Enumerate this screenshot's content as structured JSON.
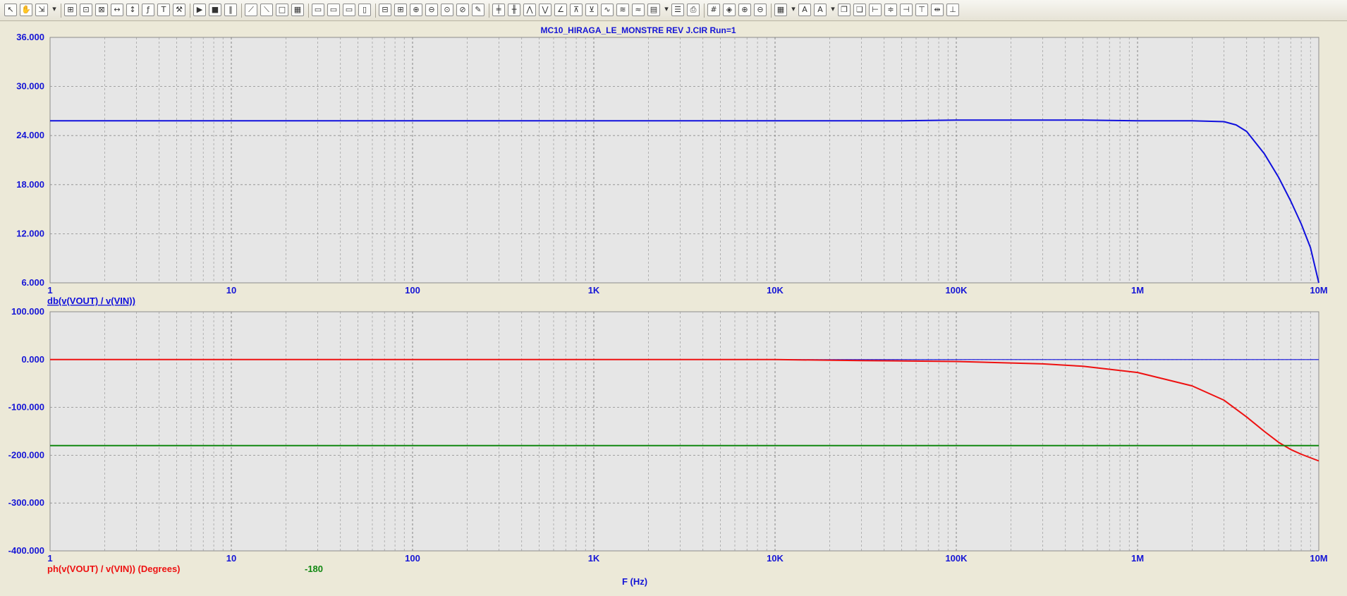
{
  "window": {
    "title": "MC10_HIRAGA_LE_MONSTRE REV J.CIR Run=1",
    "xaxis_label": "F (Hz)"
  },
  "toolbar": {
    "icons": [
      "select-arrow-icon",
      "pan-hand-icon",
      "pointer-menu-icon",
      "dropdown-arrow-icon",
      "scale-icon",
      "zoom-window-icon",
      "zoom-region-icon",
      "zoom-x-icon",
      "zoom-y-icon",
      "formula-icon",
      "text-icon",
      "tools-icon",
      "run-icon",
      "stop-icon",
      "pause-icon",
      "cursor-left-icon",
      "cursor-right-icon",
      "box-icon",
      "grid-box-icon",
      "plot-a-icon",
      "plot-b-icon",
      "plot-c-icon",
      "plot-d-icon",
      "h-split-icon",
      "v-split-icon",
      "zoom-in-icon",
      "zoom-out-icon",
      "zoom-fit-icon",
      "zoom-prev-icon",
      "edit-icon",
      "tag-1-icon",
      "tag-2-icon",
      "peak-icon",
      "valley-icon",
      "slope-icon",
      "high-icon",
      "low-icon",
      "inflection-icon",
      "global-high-icon",
      "global-low-icon",
      "clipboard-icon",
      "dropdown-arrow-icon",
      "properties-icon",
      "print-icon",
      "grid-icon",
      "marker-icon",
      "magnify-plus-icon",
      "magnify-minus-icon",
      "layout-icon",
      "dropdown-arrow-icon",
      "font-icon",
      "style-icon",
      "dropdown-arrow-icon",
      "copy-icon",
      "paste-icon",
      "align-left-icon",
      "align-center-icon",
      "align-right-icon",
      "align-top-icon",
      "distribute-icon",
      "align-bottom-icon"
    ]
  },
  "colors": {
    "plot_bg": "#e6e6e6",
    "axis_text": "#1515d6",
    "magnitude_trace": "#1010dd",
    "phase_trace": "#ee1111",
    "reference_line": "#118811",
    "zero_line": "#1010dd"
  },
  "chart_data": [
    {
      "type": "line",
      "title": "MC10_HIRAGA_LE_MONSTRE REV J.CIR Run=1",
      "xscale": "log",
      "xlim": [
        1,
        10000000
      ],
      "ylim": [
        6,
        36
      ],
      "x_ticks": [
        1,
        10,
        100,
        1000,
        10000,
        100000,
        1000000,
        10000000
      ],
      "x_tick_labels": [
        "1",
        "10",
        "100",
        "1K",
        "10K",
        "100K",
        "1M",
        "10M"
      ],
      "y_ticks": [
        6,
        12,
        18,
        24,
        30,
        36
      ],
      "y_tick_labels": [
        "6.000",
        "12.000",
        "18.000",
        "24.000",
        "30.000",
        "36.000"
      ],
      "grid": true,
      "xlabel": "",
      "series": [
        {
          "name": "db(v(VOUT) / v(VIN))",
          "x": [
            1,
            10,
            100,
            1000,
            10000,
            50000,
            100000,
            500000,
            1000000,
            2000000,
            3000000,
            3500000,
            4000000,
            5000000,
            6000000,
            7000000,
            8000000,
            9000000,
            10000000
          ],
          "y": [
            25.8,
            25.8,
            25.8,
            25.8,
            25.8,
            25.8,
            25.9,
            25.9,
            25.8,
            25.8,
            25.7,
            25.3,
            24.5,
            21.8,
            18.9,
            16.0,
            13.2,
            10.3,
            6.0
          ]
        }
      ]
    },
    {
      "type": "line",
      "xscale": "log",
      "xlim": [
        1,
        10000000
      ],
      "ylim": [
        -400,
        100
      ],
      "x_ticks": [
        1,
        10,
        100,
        1000,
        10000,
        100000,
        1000000,
        10000000
      ],
      "x_tick_labels": [
        "1",
        "10",
        "100",
        "1K",
        "10K",
        "100K",
        "1M",
        "10M"
      ],
      "y_ticks": [
        -400,
        -300,
        -200,
        -100,
        0,
        100
      ],
      "y_tick_labels": [
        "-400.000",
        "-300.000",
        "-200.000",
        "-100.000",
        "0.000",
        "100.000"
      ],
      "grid": true,
      "xlabel": "F (Hz)",
      "series": [
        {
          "name": "ph(v(VOUT) / v(VIN)) (Degrees)",
          "x": [
            1,
            10,
            100,
            1000,
            10000,
            30000,
            100000,
            300000,
            500000,
            1000000,
            2000000,
            3000000,
            4000000,
            5000000,
            6000000,
            7000000,
            8000000,
            10000000
          ],
          "y": [
            0,
            0,
            0,
            0,
            0,
            -2,
            -4,
            -9,
            -14,
            -27,
            -55,
            -85,
            -120,
            -150,
            -173,
            -188,
            -198,
            -212
          ]
        },
        {
          "name": "-180",
          "x": [
            1,
            10000000
          ],
          "y": [
            -180,
            -180
          ]
        }
      ]
    }
  ]
}
